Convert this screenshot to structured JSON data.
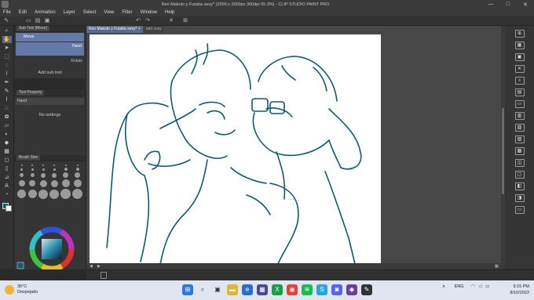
{
  "window": {
    "title": "Ren Makoto y Futaba sexy* (2000 x 2000px 300dpi 55.3%) - CLIP STUDIO PAINT PRO",
    "minimize": "—",
    "maximize": "□",
    "close": "✕"
  },
  "menu": [
    "File",
    "Edit",
    "Animation",
    "Layer",
    "Select",
    "View",
    "Filter",
    "Window",
    "Help"
  ],
  "palettes": {
    "subtool": {
      "title": "Sub Tool [Move]",
      "active_tool": "Move",
      "hand_label": "Hand",
      "rotate_label": "Rotate",
      "add": "Add sub tool"
    },
    "tool_property": {
      "title": "Tool Property",
      "tool": "Hand",
      "empty": "No settings"
    },
    "brush_size": {
      "title": "Brush Size"
    }
  },
  "tabs": [
    {
      "label": "Ren Makoto y Futaba sexy*",
      "close": "×",
      "active": true
    },
    {
      "label": "add sexy",
      "active": false
    }
  ],
  "taskbar": {
    "weather_temp": "36°C",
    "weather_desc": "Despejado",
    "lang": "ENG",
    "time": "9:15 PM",
    "date": "8/10/2022"
  },
  "icons": {
    "tools": [
      "zoom-icon",
      "hand-icon",
      "move-icon",
      "select-icon",
      "lasso-icon",
      "eyedropper-icon",
      "pen-icon",
      "pencil-icon",
      "brush-icon",
      "airbrush-icon",
      "decoration-icon",
      "eraser-icon",
      "blend-icon",
      "fill-icon",
      "gradient-icon",
      "figure-icon",
      "frame-icon",
      "ruler-icon",
      "text-icon",
      "balloon-icon"
    ],
    "right": [
      "navigator-icon",
      "layer-icon",
      "material-icon",
      "property-icon",
      "search-icon",
      "layer-new-icon",
      "folder-icon",
      "lock-icon",
      "mask-icon",
      "ref-icon",
      "clip-icon",
      "copy-icon",
      "delete-icon",
      "merge-icon",
      "export-icon",
      "settings-icon"
    ]
  }
}
